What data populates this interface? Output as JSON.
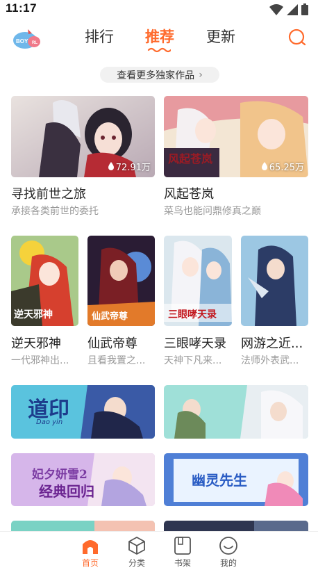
{
  "status_bar": {
    "time": "11:17"
  },
  "header": {
    "logo_text_left": "BOY",
    "logo_text_right": "RL",
    "tabs": [
      {
        "label": "排行"
      },
      {
        "label": "推荐"
      },
      {
        "label": "更新"
      }
    ],
    "active_tab": "推荐",
    "accent_color": "#ff6a2c"
  },
  "more_exclusive": {
    "label": "查看更多独家作品",
    "chevron": "›"
  },
  "featured": [
    {
      "title": "寻找前世之旅",
      "desc": "承接各类前世的委托",
      "hot": "72.91万"
    },
    {
      "title": "风起苍岚",
      "desc": "菜鸟也能问鼎修真之巅",
      "hot": "65.25万"
    }
  ],
  "grid": [
    {
      "title": "逆天邪神",
      "desc": "一代邪神出..."
    },
    {
      "title": "仙武帝尊",
      "desc": "且看我置之..."
    },
    {
      "title": "三眼哮天录",
      "desc": "天神下凡来..."
    },
    {
      "title": "网游之近...",
      "desc": "法师外表武..."
    }
  ],
  "banners": [
    {
      "name": "daoyin",
      "text": "道印",
      "sub": "Dao yin"
    },
    {
      "name": "banner-2",
      "text": ""
    },
    {
      "name": "feixi",
      "text": "妃夕妍雪2 经典回归"
    },
    {
      "name": "youling",
      "text": "幽灵先生"
    }
  ],
  "bottom_nav": [
    {
      "label": "首页",
      "icon": "home-icon",
      "active": true
    },
    {
      "label": "分类",
      "icon": "category-cube-icon",
      "active": false
    },
    {
      "label": "书架",
      "icon": "bookshelf-icon",
      "active": false
    },
    {
      "label": "我的",
      "icon": "profile-smile-icon",
      "active": false
    }
  ]
}
